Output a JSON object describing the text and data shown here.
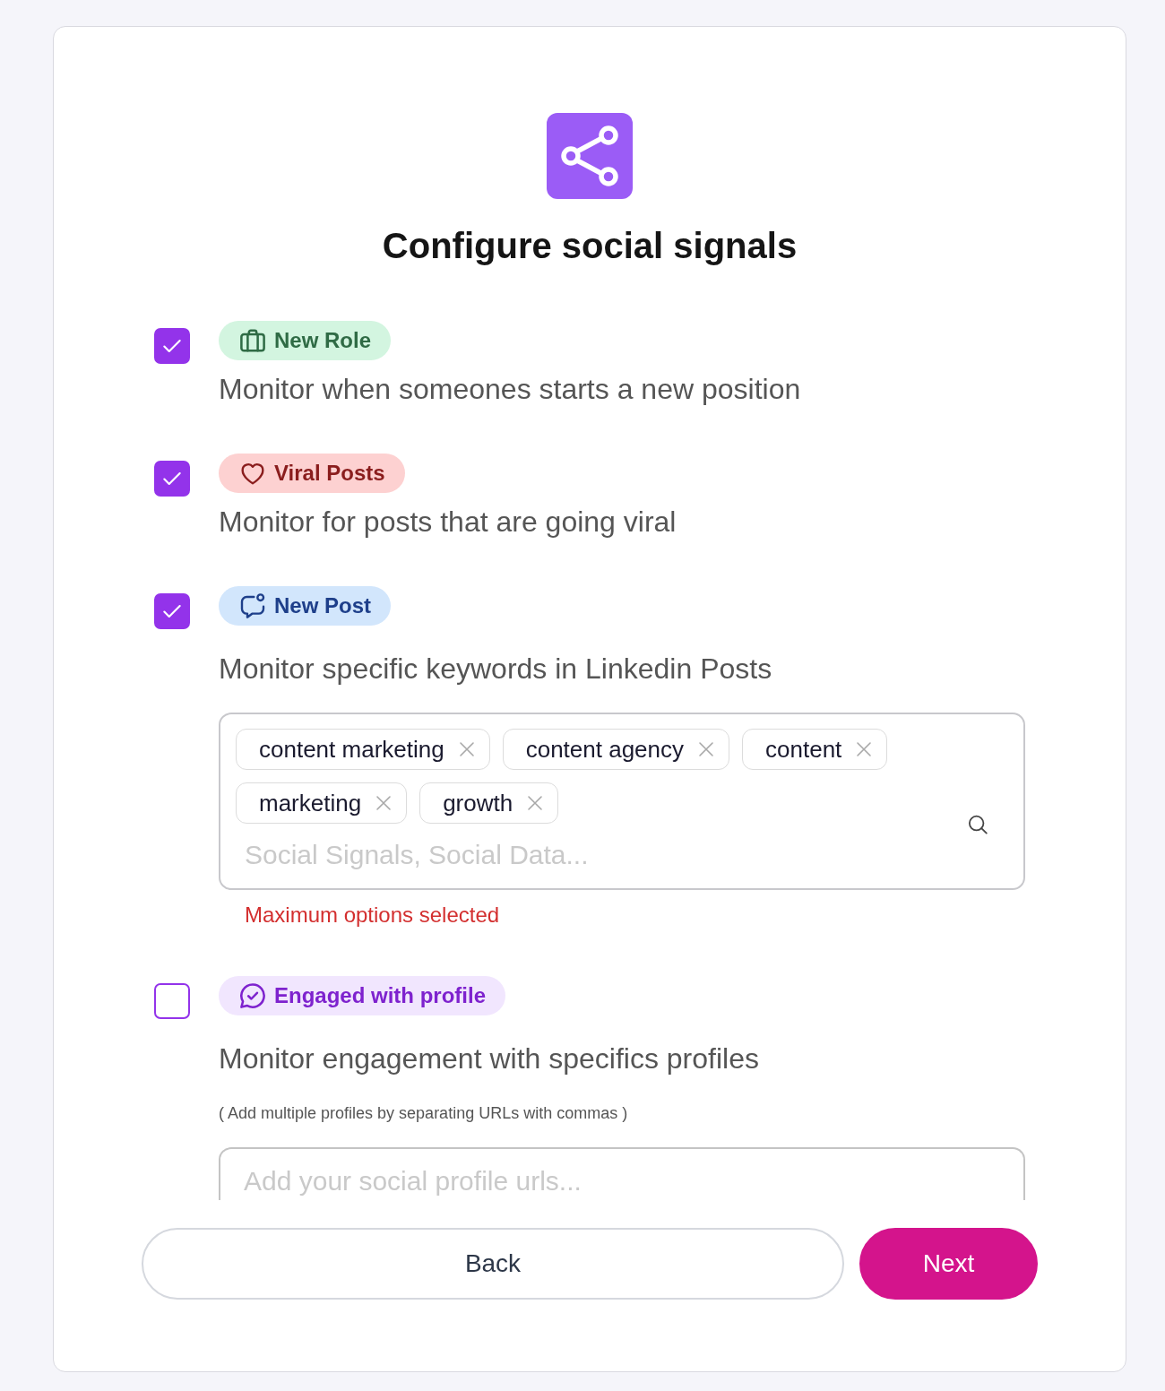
{
  "header": {
    "title": "Configure social signals"
  },
  "signals": [
    {
      "kind": "role",
      "checked": true,
      "tag": {
        "label": "New Role",
        "color": "#d3f5e0"
      },
      "description": "Monitor when someones starts a new position"
    },
    {
      "kind": "viral",
      "checked": true,
      "tag": {
        "label": "Viral Posts",
        "color": "#fdd1d1"
      },
      "description": "Monitor for posts that are going viral"
    },
    {
      "kind": "post",
      "checked": true,
      "tag": {
        "label": "New Post",
        "color": "#d2e6fc"
      },
      "description": "Monitor specific keywords in Linkedin Posts",
      "keywords": [
        "content marketing",
        "content agency",
        "content",
        "marketing",
        "growth"
      ],
      "keyword_placeholder": "Social Signals, Social Data...",
      "error": "Maximum options selected"
    },
    {
      "kind": "engagement",
      "checked": false,
      "tag": {
        "label": "Engaged with profile",
        "color": "#f1e6fe"
      },
      "description": "Monitor engagement with specifics profiles",
      "hint": "( Add multiple profiles by separating URLs with commas )",
      "profile_placeholder": "Add your social profile urls..."
    }
  ],
  "buttons": [
    {
      "label": "Back",
      "kind": "secondary"
    },
    {
      "label": "Next",
      "kind": "primary"
    }
  ]
}
